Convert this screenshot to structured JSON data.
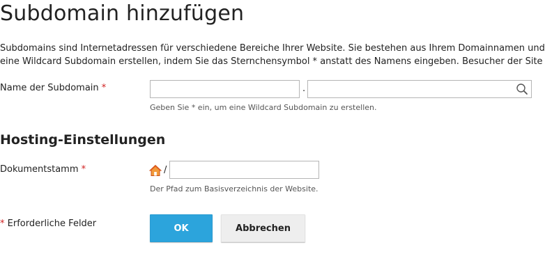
{
  "page": {
    "title": "Subdomain hinzufügen",
    "intro_line1": "Subdomains sind Internetadressen für verschiedene Bereiche Ihrer Website. Sie bestehen aus Ihrem Domainnamen und",
    "intro_line2": "eine Wildcard Subdomain erstellen, indem Sie das Sternchensymbol * anstatt des Namens eingeben. Besucher der Site w"
  },
  "subdomain": {
    "label": "Name der Subdomain",
    "required_marker": "*",
    "name_value": "",
    "separator": ".",
    "domain_value": "",
    "hint": "Geben Sie * ein, um eine Wildcard Subdomain zu erstellen."
  },
  "hosting": {
    "section_title": "Hosting-Einstellungen",
    "docroot_label": "Dokumentstamm",
    "required_marker": "*",
    "home_icon": "home-icon",
    "slash": "/",
    "docroot_value": "",
    "hint": "Der Pfad zum Basisverzeichnis der Website."
  },
  "footer": {
    "required_marker": "*",
    "required_text": "Erforderliche Felder"
  },
  "buttons": {
    "ok_label": "OK",
    "cancel_label": "Abbrechen"
  },
  "colors": {
    "primary_button": "#2ca4dc",
    "required_marker": "#d02020",
    "home_icon_roof": "#e25b1c",
    "home_icon_body": "#f29a3a"
  }
}
